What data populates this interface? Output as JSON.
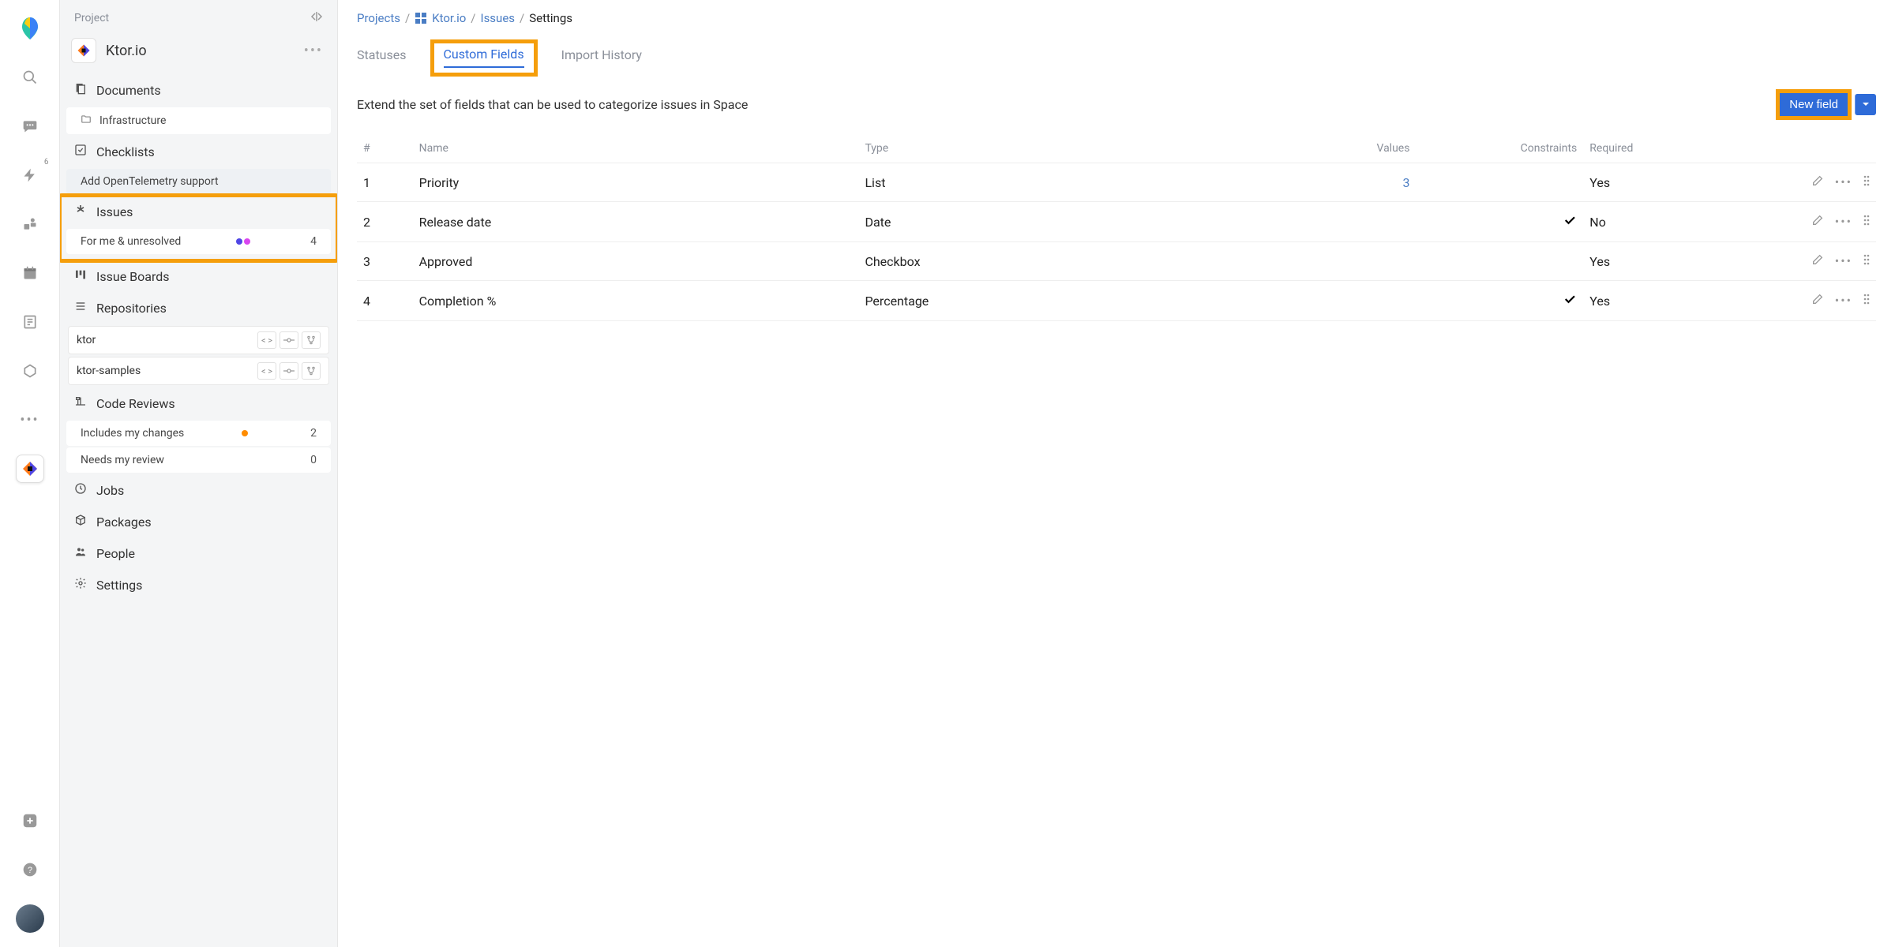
{
  "sidebar": {
    "headerLabel": "Project",
    "projectName": "Ktor.io",
    "sections": {
      "documents": {
        "label": "Documents",
        "items": [
          "Infrastructure"
        ]
      },
      "checklists": {
        "label": "Checklists",
        "items": [
          "Add OpenTelemetry support"
        ]
      },
      "issues": {
        "label": "Issues",
        "filter": {
          "label": "For me & unresolved",
          "count": "4"
        }
      },
      "issueBoards": {
        "label": "Issue Boards"
      },
      "repositories": {
        "label": "Repositories",
        "repos": [
          "ktor",
          "ktor-samples"
        ]
      },
      "codeReviews": {
        "label": "Code Reviews",
        "includesLabel": "Includes my changes",
        "includesCount": "2",
        "needsLabel": "Needs my review",
        "needsCount": "0"
      },
      "jobs": {
        "label": "Jobs"
      },
      "packages": {
        "label": "Packages"
      },
      "people": {
        "label": "People"
      },
      "settings": {
        "label": "Settings"
      }
    }
  },
  "rail": {
    "lightningBadge": "6"
  },
  "breadcrumb": {
    "projects": "Projects",
    "project": "Ktor.io",
    "issues": "Issues",
    "current": "Settings"
  },
  "tabs": {
    "statuses": "Statuses",
    "customFields": "Custom Fields",
    "importHistory": "Import History"
  },
  "subtitle": "Extend the set of fields that can be used to categorize issues in Space",
  "newFieldLabel": "New field",
  "table": {
    "headers": {
      "idx": "#",
      "name": "Name",
      "type": "Type",
      "values": "Values",
      "constraints": "Constraints",
      "required": "Required"
    },
    "rows": [
      {
        "idx": "1",
        "name": "Priority",
        "type": "List",
        "values": "3",
        "constraints": "",
        "required": "Yes"
      },
      {
        "idx": "2",
        "name": "Release date",
        "type": "Date",
        "values": "",
        "constraints": "check",
        "required": "No",
        "requiredMuted": true
      },
      {
        "idx": "3",
        "name": "Approved",
        "type": "Checkbox",
        "values": "",
        "constraints": "",
        "required": "Yes"
      },
      {
        "idx": "4",
        "name": "Completion %",
        "type": "Percentage",
        "values": "",
        "constraints": "check",
        "required": "Yes"
      }
    ]
  }
}
